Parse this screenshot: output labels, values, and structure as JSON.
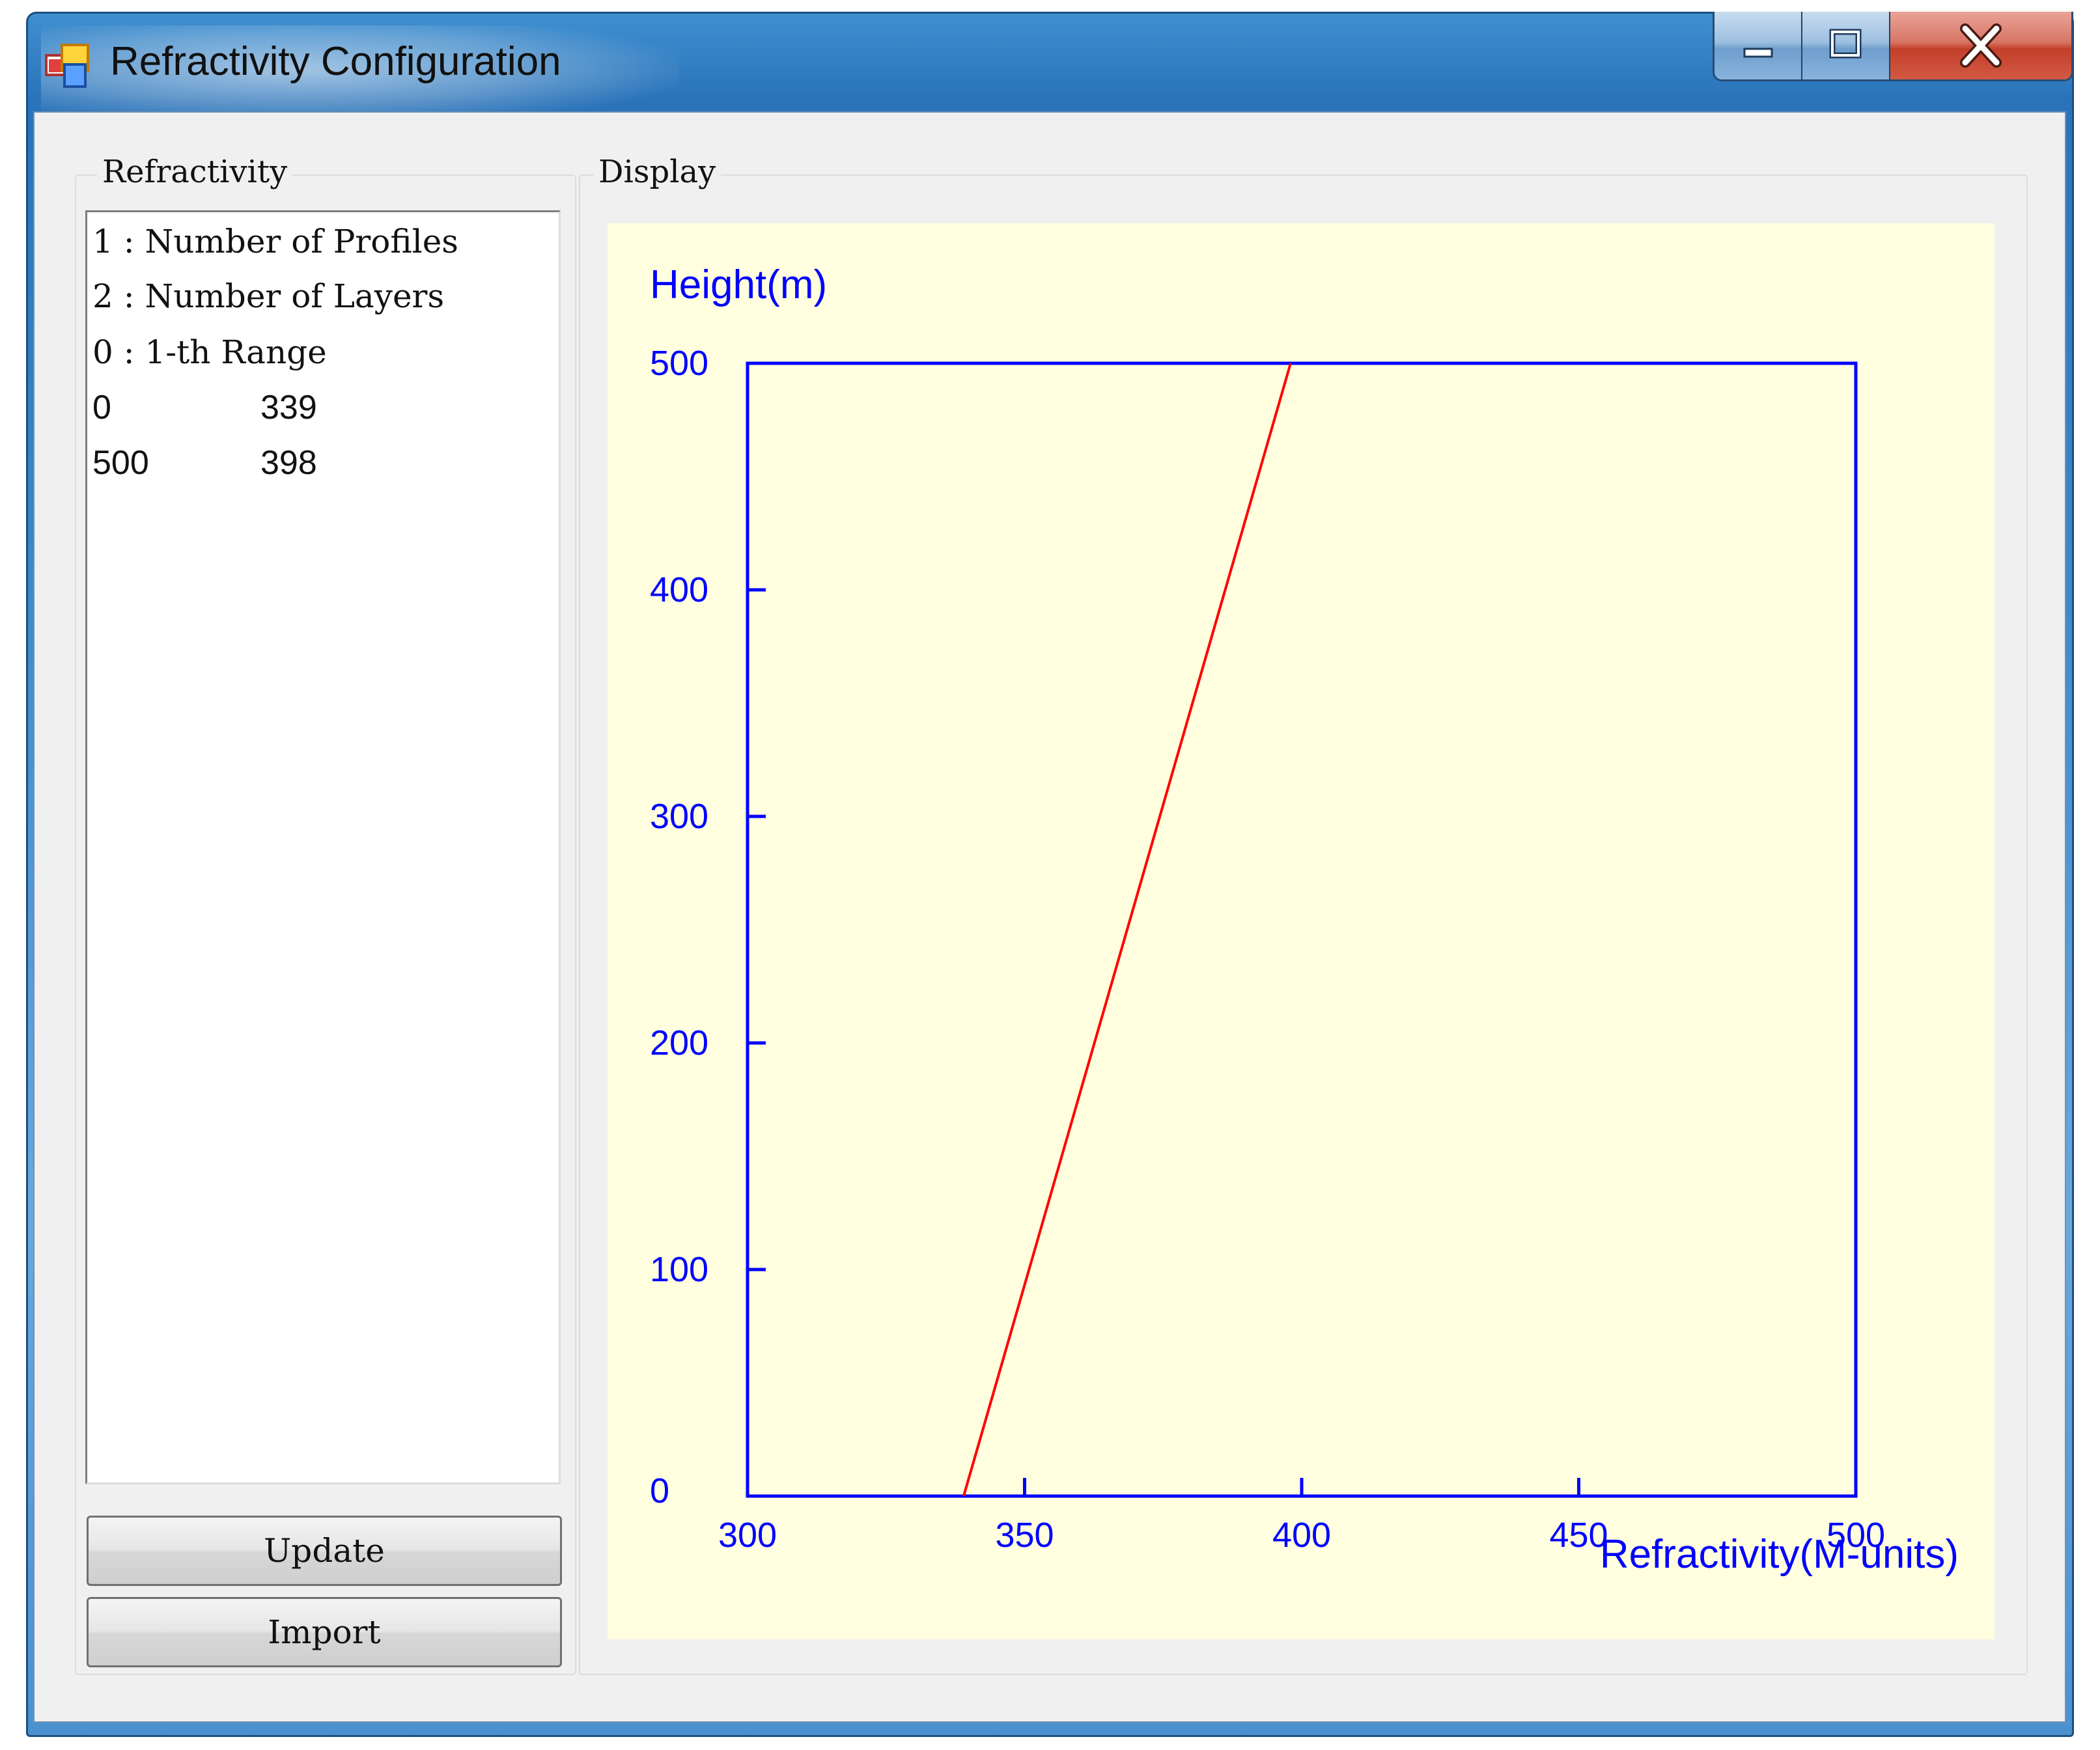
{
  "window": {
    "title": "Refractivity Configuration",
    "icons": {
      "app": "app-window-icon",
      "minimize": "minimize-icon",
      "maximize": "maximize-icon",
      "close": "close-icon"
    }
  },
  "refractivity_group": {
    "legend": "Refractivity",
    "list": [
      {
        "a": "1 : Number of Profiles",
        "b": ""
      },
      {
        "a": "2 : Number of Layers",
        "b": ""
      },
      {
        "a": "0 : 1-th Range",
        "b": ""
      },
      {
        "a": "0",
        "b": "339"
      },
      {
        "a": "500",
        "b": "398"
      }
    ],
    "update_label": "Update",
    "import_label": "Import"
  },
  "display_group": {
    "legend": "Display"
  },
  "colors": {
    "axis": "#0000ff",
    "line": "#ff0000",
    "plot_bg": "#ffffe0"
  },
  "chart_data": {
    "type": "line",
    "ylabel": "Height(m)",
    "xlabel": "Refractivity(M-units)",
    "xlim": [
      300,
      500
    ],
    "ylim": [
      0,
      500
    ],
    "xticks": [
      300,
      350,
      400,
      450,
      500
    ],
    "yticks": [
      0,
      100,
      200,
      300,
      400,
      500
    ],
    "grid": false,
    "series": [
      {
        "x": [
          339,
          398
        ],
        "y": [
          0,
          500
        ]
      }
    ]
  }
}
